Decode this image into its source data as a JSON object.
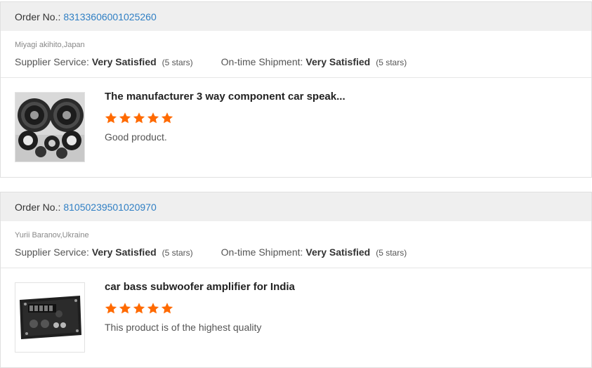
{
  "accent_color": "#2f7fc4",
  "star_color": "#ff6a00",
  "reviews": [
    {
      "order_label": "Order No.:",
      "order_number": "83133606001025260",
      "buyer": "Miyagi akihito,Japan",
      "supplier_service_label": "Supplier Service:",
      "supplier_service_value": "Very Satisfied",
      "supplier_service_stars": "(5 stars)",
      "shipment_label": "On-time Shipment:",
      "shipment_value": "Very Satisfied",
      "shipment_stars": "(5 stars)",
      "product_title": "The manufacturer 3 way component car speak...",
      "product_image_icon": "car-speaker-set-image",
      "rating": 5,
      "review_text": "Good product."
    },
    {
      "order_label": "Order No.:",
      "order_number": "81050239501020970",
      "buyer": "Yurii Baranov,Ukraine",
      "supplier_service_label": "Supplier Service:",
      "supplier_service_value": "Very Satisfied",
      "supplier_service_stars": "(5 stars)",
      "shipment_label": "On-time Shipment:",
      "shipment_value": "Very Satisfied",
      "shipment_stars": "(5 stars)",
      "product_title": "car bass subwoofer amplifier for India",
      "product_image_icon": "amplifier-board-image",
      "rating": 5,
      "review_text": "This product is of the highest quality"
    }
  ]
}
